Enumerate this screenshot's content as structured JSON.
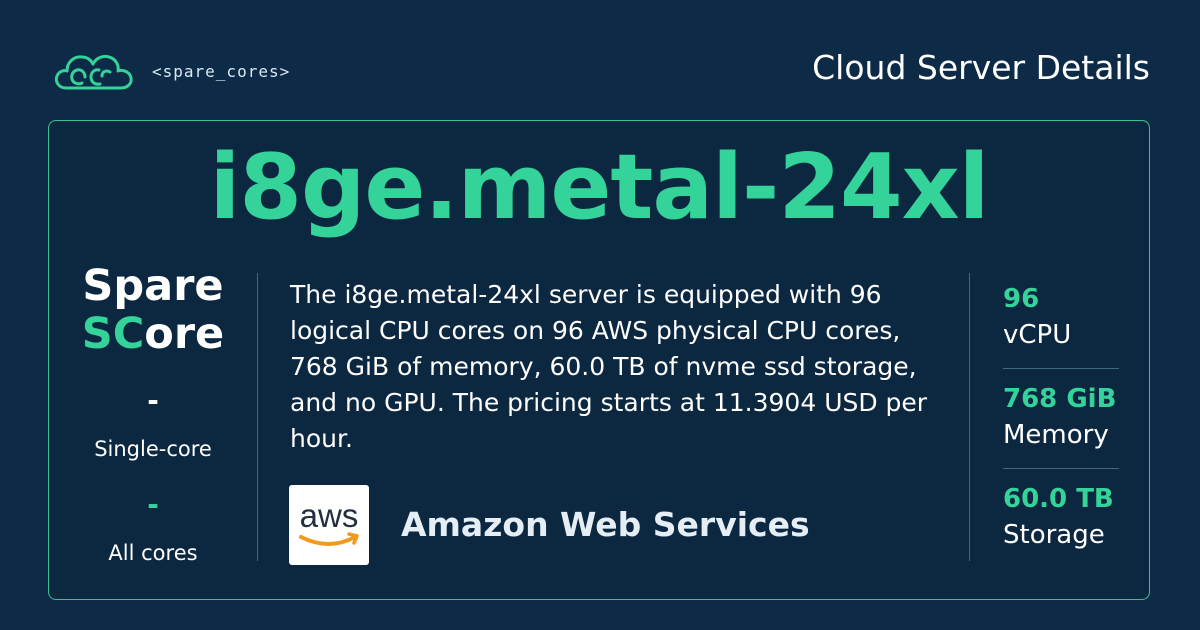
{
  "brand": {
    "name": "<spare_cores>",
    "logo_icon": "cloud-logo-icon",
    "accent_color": "#34d399"
  },
  "header": {
    "title": "Cloud Server Details"
  },
  "server": {
    "name": "i8ge.metal-24xl",
    "description": "The i8ge.metal-24xl server is equipped with 96 logical CPU cores on 96 AWS physical CPU cores, 768 GiB of memory, 60.0 TB of nvme ssd storage, and no GPU. The pricing starts at 11.3904 USD per hour."
  },
  "score": {
    "logo_line1": "Spare",
    "logo_line2_green": "SC",
    "logo_line2_white": "ore",
    "single_core_value": "-",
    "single_core_label": "Single-core",
    "all_cores_value": "-",
    "all_cores_label": "All cores"
  },
  "vendor": {
    "logo_text": "aws",
    "name": "Amazon Web Services"
  },
  "specs": [
    {
      "value": "96",
      "label": "vCPU"
    },
    {
      "value": "768 GiB",
      "label": "Memory"
    },
    {
      "value": "60.0 TB",
      "label": "Storage"
    }
  ],
  "colors": {
    "background": "#0d2b47",
    "card_border": "#3fbe8e",
    "accent": "#34d399",
    "aws_orange": "#f29a1b"
  }
}
